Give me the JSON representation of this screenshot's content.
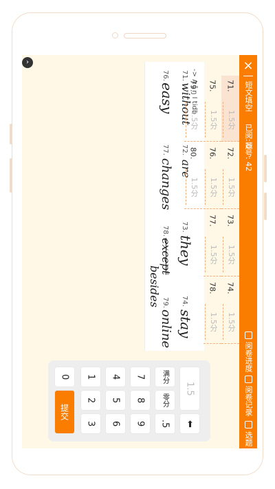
{
  "header": {
    "title": "短文填空",
    "read_count": "已阅: 0",
    "question_no": "题号: 42",
    "progress_label": "阅卷进度",
    "records_label": "阅卷记录",
    "choose_label": "选题"
  },
  "grid": {
    "rows": [
      [
        {
          "num": "71.",
          "score": "1.5分"
        },
        {
          "num": "72.",
          "score": "1.5分"
        },
        {
          "num": "73.",
          "score": "1.5分"
        },
        {
          "num": "74.",
          "score": "1.5分"
        }
      ],
      [
        {
          "num": "75.",
          "score": "1.5分"
        },
        {
          "num": "76.",
          "score": "1.5分"
        },
        {
          "num": "77.",
          "score": "1.5分"
        },
        {
          "num": "78.",
          "score": "1.5分"
        }
      ],
      [
        {
          "num": "79.",
          "score": "1.5分"
        },
        {
          "num": "80.",
          "score": "1.5分"
        }
      ]
    ]
  },
  "handwriting": {
    "w71": "without",
    "w72": "are",
    "w73": "they",
    "w74": "stay",
    "w76": "easy",
    "w77": "changes",
    "w78": "except",
    "w78b": "besides",
    "w79": "online",
    "l71": "71.",
    "l72": "72.",
    "l73": "73.",
    "l74": "74.",
    "l76": "76.",
    "l77": "77.",
    "l78": "78.",
    "l79": "79.",
    "top_text": "-> A  ĵ ŋ I tidb"
  },
  "keypad": {
    "k0": "0",
    "k1": "1",
    "k2": "2",
    "k3": "3",
    "k4": "4",
    "k5": "5",
    "k6": "6",
    "k7": "7",
    "k8": "8",
    "k9": "9",
    "kdot": ".5",
    "full": "满分",
    "zero": "零分",
    "backspace": "⬅",
    "submit": "提交",
    "display": "1.5"
  },
  "icons": {
    "close": "×",
    "collapse": "›"
  },
  "colors": {
    "accent": "#fa7d00",
    "background": "#fff8e6"
  }
}
